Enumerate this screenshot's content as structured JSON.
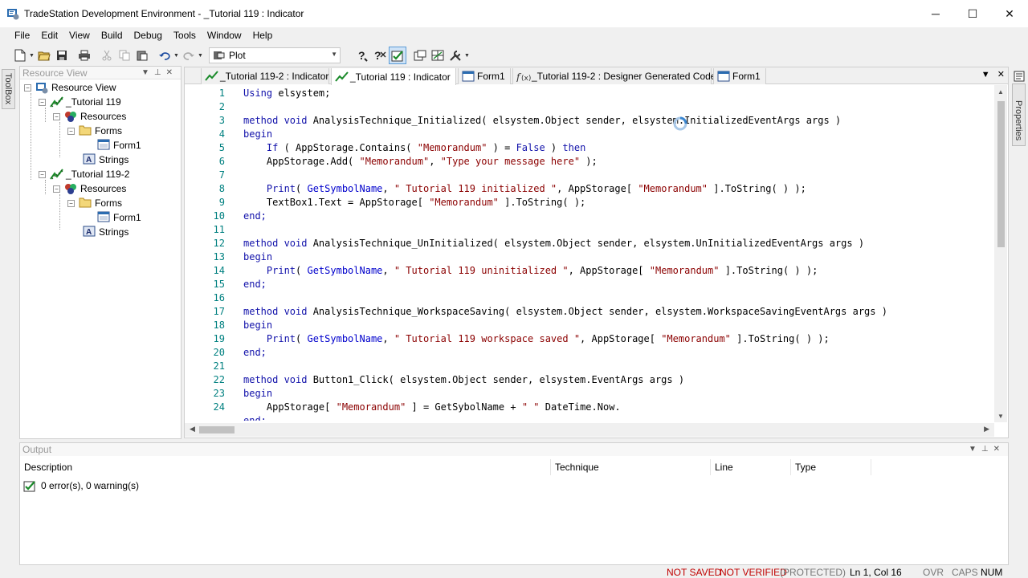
{
  "window": {
    "title": "TradeStation Development Environment - _Tutorial 119 : Indicator",
    "minimize": "─",
    "maximize": "☐",
    "close": "✕"
  },
  "menu": [
    "File",
    "Edit",
    "View",
    "Build",
    "Debug",
    "Tools",
    "Window",
    "Help"
  ],
  "toolbar": {
    "combo_value": "Plot"
  },
  "toolbox_tab": "ToolBox",
  "properties_tab": "Properties",
  "resource_view": {
    "header": "Resource View",
    "root": "Resource View",
    "nodes": [
      {
        "label": "_Tutorial 119"
      },
      {
        "label": "Resources"
      },
      {
        "label": "Forms"
      },
      {
        "label": "Form1"
      },
      {
        "label": "Strings"
      },
      {
        "label": "_Tutorial 119-2"
      },
      {
        "label": "Resources"
      },
      {
        "label": "Forms"
      },
      {
        "label": "Form1"
      },
      {
        "label": "Strings"
      }
    ]
  },
  "tabs": [
    {
      "label": "_Tutorial 119-2 : Indicator"
    },
    {
      "label": "_Tutorial 119 : Indicator"
    },
    {
      "label": "Form1"
    },
    {
      "label": "_Tutorial 119-2 : Designer Generated Code"
    },
    {
      "label": "Form1"
    }
  ],
  "code_lines": [
    {
      "n": "1"
    },
    {
      "n": "2"
    },
    {
      "n": "3"
    },
    {
      "n": "4"
    },
    {
      "n": "5"
    },
    {
      "n": "6"
    },
    {
      "n": "7"
    },
    {
      "n": "8"
    },
    {
      "n": "9"
    },
    {
      "n": "10"
    },
    {
      "n": "11"
    },
    {
      "n": "12"
    },
    {
      "n": "13"
    },
    {
      "n": "14"
    },
    {
      "n": "15"
    },
    {
      "n": "16"
    },
    {
      "n": "17"
    },
    {
      "n": "18"
    },
    {
      "n": "19"
    },
    {
      "n": "20"
    },
    {
      "n": "21"
    },
    {
      "n": "22"
    },
    {
      "n": "23"
    },
    {
      "n": "24"
    }
  ],
  "code": {
    "l1a": "Using",
    "l1b": " elsystem;",
    "l3a": "method void",
    "l3b": " AnalysisTechnique_Initialized( elsystem.Object sender, elsystem.InitializedEventArgs args )",
    "begin": "begin",
    "end": "end;",
    "l5a": "If",
    "l5b": " ( AppStorage.Contains( ",
    "l5c": "\"Memorandum\"",
    "l5d": " ) = ",
    "l5e": "False",
    "l5f": " ) ",
    "l5g": "then",
    "l6a": "AppStorage.Add( ",
    "l6b": "\"Memorandum\"",
    "l6c": ", ",
    "l6d": "\"Type your message here\"",
    "l6e": " );",
    "print": "Print",
    "l8b": "( ",
    "gsn": "GetSymbolName",
    "comma": ", ",
    "l8s": "\" Tutorial 119 initialized \"",
    "l8c": ", AppStorage[ ",
    "memo": "\"Memorandum\"",
    "l8d": " ].ToString( ) );",
    "l9a": "TextBox1.Text = AppStorage[ ",
    "l9c": " ].ToString( );",
    "l12a": "method void",
    "l12b": " AnalysisTechnique_UnInitialized( elsystem.Object sender, elsystem.UnInitializedEventArgs args )",
    "l14s": "\" Tutorial 119 uninitialized \"",
    "l17a": "method void",
    "l17b": " AnalysisTechnique_WorkspaceSaving( elsystem.Object sender, elsystem.WorkspaceSavingEventArgs args )",
    "l19s": "\" Tutorial 119 workspace saved \"",
    "l22a": "method void",
    "l22b": " Button1_Click( elsystem.Object sender, elsystem.EventArgs args )",
    "l24a": "AppStorage[ ",
    "l24c": " ] = GetSybolName + ",
    "l24d": "\" \"",
    "l24e": " DateTime.Now."
  },
  "output": {
    "header": "Output",
    "columns": [
      "Description",
      "Technique",
      "Line",
      "Type"
    ],
    "message": "0 error(s), 0 warning(s)"
  },
  "status": {
    "not_saved": "NOT SAVED",
    "not_verified": "NOT VERIFIED",
    "protected": "(PROTECTED)",
    "position": "Ln 1, Col 16",
    "ovr": "OVR",
    "caps": "CAPS",
    "num": "NUM"
  },
  "colors": {
    "keyword": "#1111aa",
    "string": "#8b0000",
    "line_number": "#008080",
    "status_red": "#c00000"
  }
}
